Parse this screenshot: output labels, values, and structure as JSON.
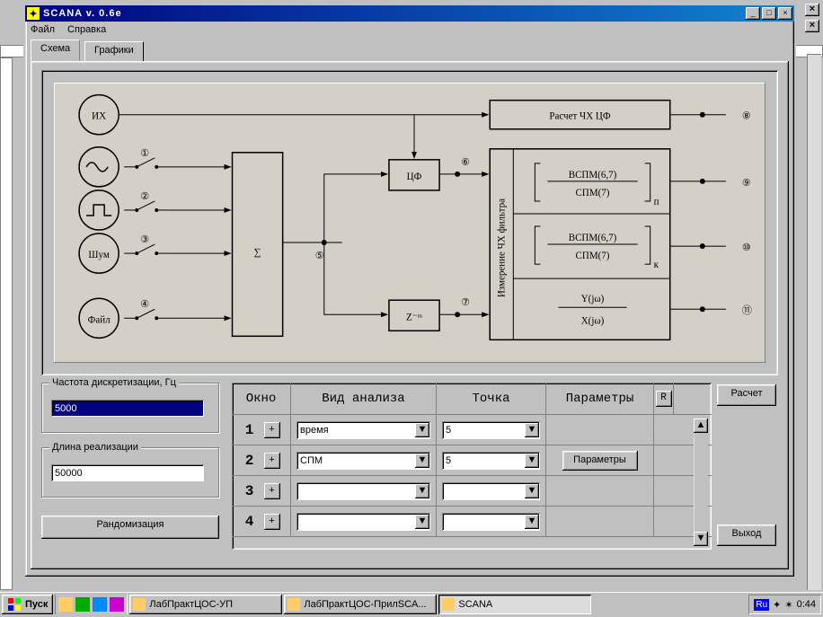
{
  "window": {
    "title": "SCANA v. 0.6e",
    "minimize": "_",
    "maximize": "□",
    "close": "×"
  },
  "menu": {
    "file": "Файл",
    "help": "Справка"
  },
  "tabs": {
    "scheme": "Схема",
    "graphs": "Графики"
  },
  "diagram": {
    "ih": "ИХ",
    "noise": "Шум",
    "file": "Файл",
    "sum": "∑",
    "cf": "ЦФ",
    "zm": "Z⁻ᵐ",
    "freq_calc": "Расчет ЧХ ЦФ",
    "meas": "Измерение ЧХ фильтра",
    "ratio_top_num": "ВСПМ(6,7)",
    "ratio_top_den": "СПМ(7)",
    "ratio_sub_p": "п",
    "ratio_sub_k": "к",
    "yjw": "Y(jω)",
    "xjw": "X(jω)",
    "n1": "①",
    "n2": "②",
    "n3": "③",
    "n4": "④",
    "n5": "⑤",
    "n6": "⑥",
    "n7": "⑦",
    "n8": "⑧",
    "n9": "⑨",
    "n10": "⑩",
    "n11": "⑪"
  },
  "freq_group": {
    "legend": "Частота дискретизации, Гц",
    "value": "5000"
  },
  "len_group": {
    "legend": "Длина реализации",
    "value": "50000"
  },
  "buttons": {
    "randomize": "Рандомизация",
    "calc": "Расчет",
    "exit": "Выход",
    "params": "Параметры",
    "r": "R"
  },
  "grid": {
    "headers": {
      "okno": "Окно",
      "vid": "Вид анализа",
      "tochka": "Точка",
      "param": "Параметры"
    },
    "rows": [
      {
        "n": "1",
        "vid": "время",
        "tochka": "5",
        "has_param": false
      },
      {
        "n": "2",
        "vid": "СПМ",
        "tochka": "5",
        "has_param": true
      },
      {
        "n": "3",
        "vid": "",
        "tochka": "",
        "has_param": false
      },
      {
        "n": "4",
        "vid": "",
        "tochka": "",
        "has_param": false
      }
    ],
    "plus": "+",
    "dd": "▼",
    "up": "▲",
    "dn": "▼"
  },
  "taskbar": {
    "start": "Пуск",
    "items": [
      {
        "label": "ЛабПрактЦОС-УП",
        "active": false
      },
      {
        "label": "ЛабПрактЦОС-ПрилSCA...",
        "active": false
      },
      {
        "label": "SCANA",
        "active": true
      }
    ],
    "lang": "Ru",
    "clock": "0:44"
  }
}
